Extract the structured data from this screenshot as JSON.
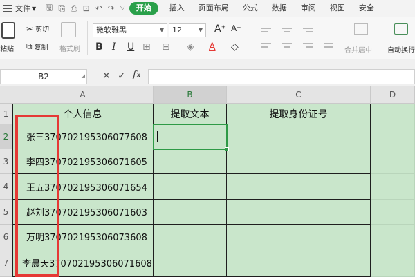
{
  "menubar": {
    "file_label": "文件",
    "tabs": [
      {
        "label": "开始",
        "active": true
      },
      {
        "label": "插入",
        "active": false
      },
      {
        "label": "页面布局",
        "active": false
      },
      {
        "label": "公式",
        "active": false
      },
      {
        "label": "数据",
        "active": false
      },
      {
        "label": "审阅",
        "active": false
      },
      {
        "label": "视图",
        "active": false
      },
      {
        "label": "安全",
        "active": false
      }
    ]
  },
  "ribbon": {
    "paste_label": "粘贴",
    "cut_label": "剪切",
    "copy_label": "复制",
    "format_painter_label": "格式刷",
    "font_name": "微软雅黑",
    "font_size": "12",
    "grow_font": "A⁺",
    "shrink_font": "A⁻",
    "bold": "B",
    "italic": "I",
    "underline": "U",
    "font_color": "A",
    "merge_label": "合并居中",
    "wrap_label": "自动换行"
  },
  "formula_bar": {
    "name_box": "B2",
    "fx_label": "fx",
    "content": ""
  },
  "sheet": {
    "columns": [
      "A",
      "B",
      "C",
      "D"
    ],
    "rows": [
      "1",
      "2",
      "3",
      "4",
      "5",
      "6",
      "7"
    ],
    "selected_column": "B",
    "selected_row": "2",
    "header_row": [
      "个人信息",
      "提取文本",
      "提取身份证号"
    ],
    "data": [
      "张三370702195306077608",
      "李四370702195306071605",
      "王五370702195306071654",
      "赵刘370702195306071603",
      "万明370702195306073608",
      "李晨天370702195306071608"
    ]
  },
  "colors": {
    "accent_green": "#2aa04a",
    "sheet_background": "#c9e6cb",
    "highlight_red": "#e53935"
  }
}
